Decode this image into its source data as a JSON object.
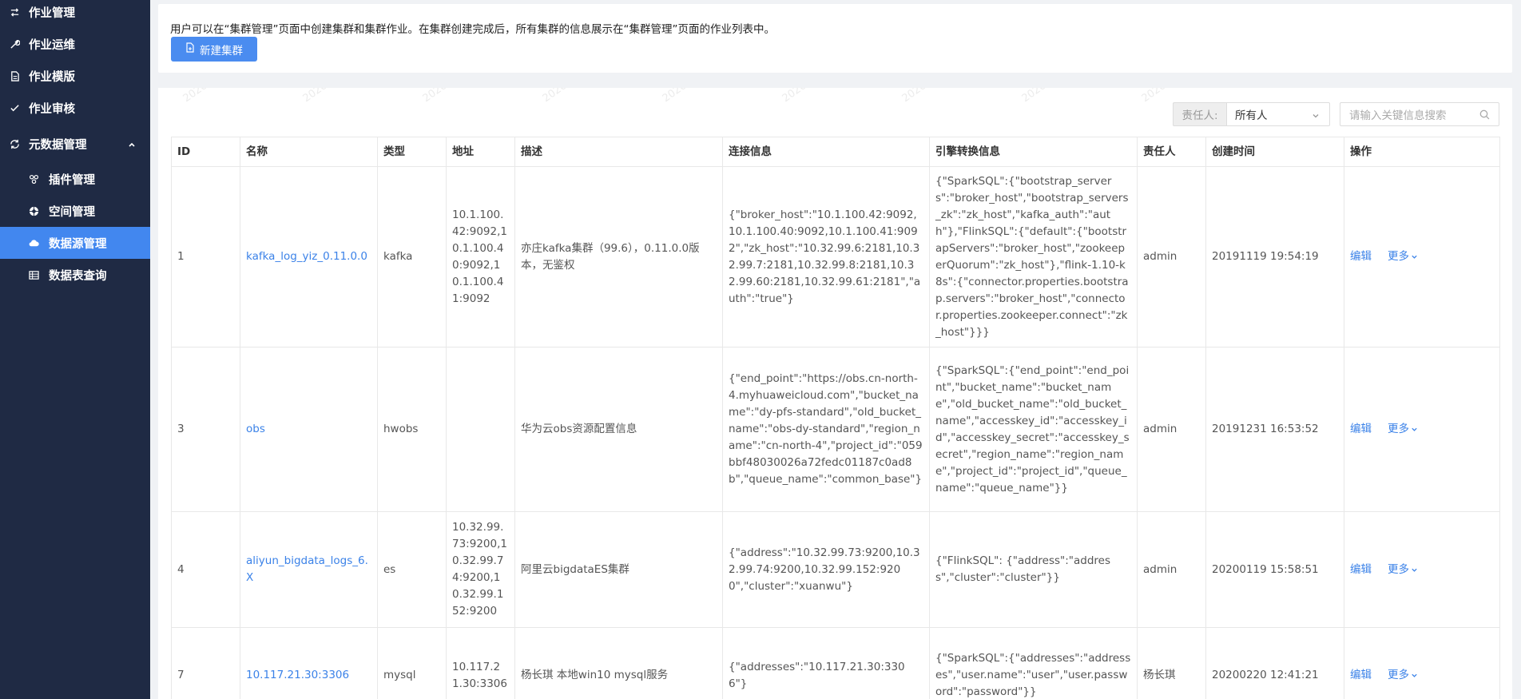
{
  "sidebar": {
    "items": [
      {
        "label": "作业管理",
        "icon": "job-manage-icon"
      },
      {
        "label": "作业运维",
        "icon": "wrench-icon"
      },
      {
        "label": "作业模版",
        "icon": "file-icon"
      },
      {
        "label": "作业审核",
        "icon": "check-icon"
      },
      {
        "label": "元数据管理",
        "icon": "refresh-icon"
      }
    ],
    "sub_items": [
      {
        "label": "插件管理",
        "icon": "plugin-icon"
      },
      {
        "label": "空间管理",
        "icon": "space-icon"
      },
      {
        "label": "数据源管理",
        "icon": "cloud-icon",
        "active": true
      },
      {
        "label": "数据表查询",
        "icon": "table-icon"
      }
    ]
  },
  "info": {
    "text": "用户可以在“集群管理”页面中创建集群和集群作业。在集群创建完成后，所有集群的信息展示在“集群管理”页面的作业列表中。",
    "new_button": "新建集群"
  },
  "filter": {
    "owner_label": "责任人:",
    "owner_value": "所有人",
    "search_placeholder": "请输入关键信息搜索"
  },
  "watermark": "2020",
  "table": {
    "headers": [
      "ID",
      "名称",
      "类型",
      "地址",
      "描述",
      "连接信息",
      "引擎转换信息",
      "责任人",
      "创建时间",
      "操作"
    ],
    "rows": [
      {
        "id": "1",
        "name": "kafka_log_yiz_0.11.0.0",
        "type": "kafka",
        "address": "10.1.100.42:9092,10.1.100.40:9092,10.1.100.41:9092",
        "desc": "亦庄kafka集群（99.6），0.11.0.0版本，无鉴权",
        "conn": "{\"broker_host\":\"10.1.100.42:9092,10.1.100.40:9092,10.1.100.41:9092\",\"zk_host\":\"10.32.99.6:2181,10.32.99.7:2181,10.32.99.8:2181,10.32.99.60:2181,10.32.99.61:2181\",\"auth\":\"true\"}",
        "engine": "{\"SparkSQL\":{\"bootstrap_servers\":\"broker_host\",\"bootstrap_servers_zk\":\"zk_host\",\"kafka_auth\":\"auth\"},\"FlinkSQL\":{\"default\":{\"bootstrapServers\":\"broker_host\",\"zookeeperQuorum\":\"zk_host\"},\"flink-1.10-k8s\":{\"connector.properties.bootstrap.servers\":\"broker_host\",\"connector.properties.zookeeper.connect\":\"zk_host\"}}}",
        "owner": "admin",
        "created": "20191119 19:54:19",
        "edit": "编辑",
        "more": "更多"
      },
      {
        "id": "3",
        "name": "obs",
        "type": "hwobs",
        "address": "",
        "desc": "华为云obs资源配置信息",
        "conn": "{\"end_point\":\"https://obs.cn-north-4.myhuaweicloud.com\",\"bucket_name\":\"dy-pfs-standard\",\"old_bucket_name\":\"obs-dy-standard\",\"region_name\":\"cn-north-4\",\"project_id\":\"059bbf48030026a72fedc01187c0ad8b\",\"queue_name\":\"common_base\"}",
        "engine": "{\"SparkSQL\":{\"end_point\":\"end_point\",\"bucket_name\":\"bucket_name\",\"old_bucket_name\":\"old_bucket_name\",\"accesskey_id\":\"accesskey_id\",\"accesskey_secret\":\"accesskey_secret\",\"region_name\":\"region_name\",\"project_id\":\"project_id\",\"queue_name\":\"queue_name\"}}",
        "owner": "admin",
        "created": "20191231 16:53:52",
        "edit": "编辑",
        "more": "更多"
      },
      {
        "id": "4",
        "name": "aliyun_bigdata_logs_6.X",
        "type": "es",
        "address": "10.32.99.73:9200,10.32.99.74:9200,10.32.99.152:9200",
        "desc": "阿里云bigdataES集群",
        "conn": "{\"address\":\"10.32.99.73:9200,10.32.99.74:9200,10.32.99.152:9200\",\"cluster\":\"xuanwu\"}",
        "engine": "{\"FlinkSQL\": {\"address\":\"address\",\"cluster\":\"cluster\"}}",
        "owner": "admin",
        "created": "20200119 15:58:51",
        "edit": "编辑",
        "more": "更多"
      },
      {
        "id": "7",
        "name": "10.117.21.30:3306",
        "type": "mysql",
        "address": "10.117.21.30:3306",
        "desc": "杨长琪 本地win10 mysql服务",
        "conn": "{\"addresses\":\"10.117.21.30:3306\"}",
        "engine": "{\"SparkSQL\":{\"addresses\":\"addresses\",\"user.name\":\"user\",\"user.password\":\"password\"}}",
        "owner": "杨长琪",
        "created": "20200220 12:41:21",
        "edit": "编辑",
        "more": "更多"
      }
    ]
  }
}
